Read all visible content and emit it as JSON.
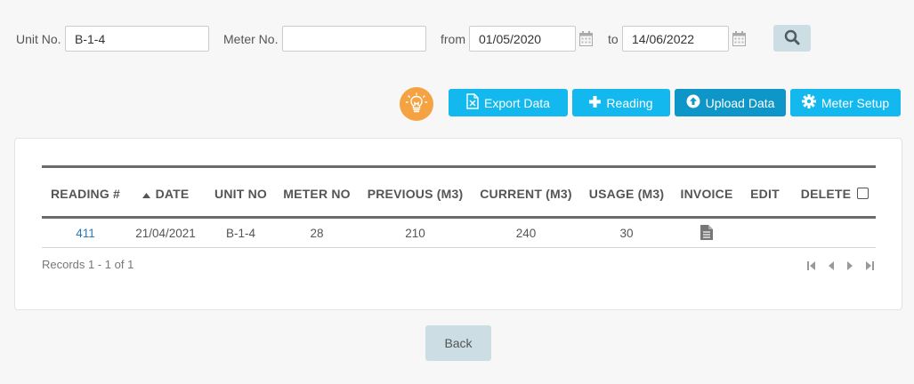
{
  "filters": {
    "unit_label": "Unit No.",
    "unit_value": "B-1-4",
    "meter_label": "Meter No.",
    "meter_value": "",
    "from_label": "from",
    "from_value": "01/05/2020",
    "to_label": "to",
    "to_value": "14/06/2022"
  },
  "actions": {
    "export_label": "Export Data",
    "reading_label": "Reading",
    "upload_label": "Upload Data",
    "setup_label": "Meter Setup"
  },
  "table": {
    "columns": [
      "READING #",
      "DATE",
      "UNIT NO",
      "METER NO",
      "PREVIOUS (M3)",
      "CURRENT (M3)",
      "USAGE (M3)",
      "INVOICE",
      "EDIT",
      "DELETE"
    ],
    "rows": [
      {
        "reading": "411",
        "date": "21/04/2021",
        "unit": "B-1-4",
        "meter": "28",
        "previous": "210",
        "current": "240",
        "usage": "30"
      }
    ],
    "records_text": "Records 1 - 1 of 1"
  },
  "back_label": "Back",
  "colors": {
    "accent": "#12b8ee",
    "accent_dark": "#0d96c7",
    "bulb": "#f5a342",
    "link": "#2a7ab8"
  }
}
